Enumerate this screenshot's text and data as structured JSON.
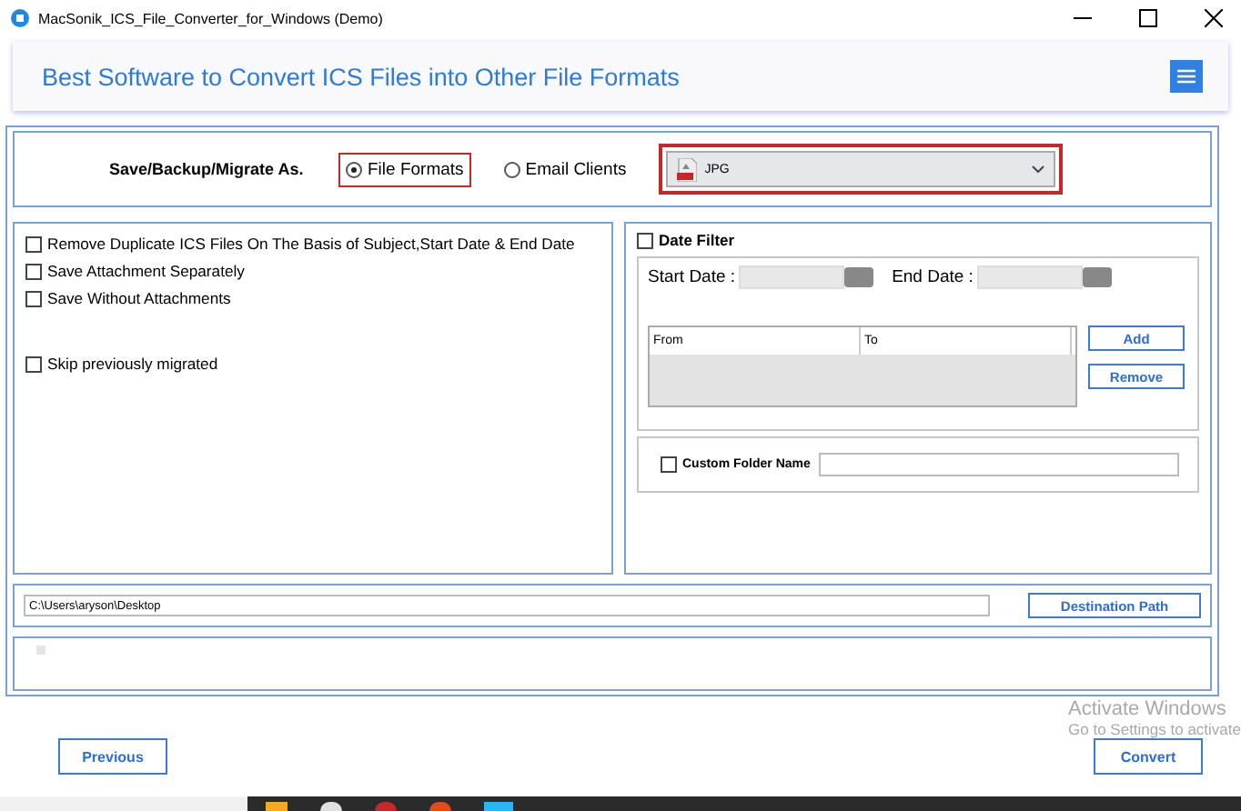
{
  "window": {
    "title": "MacSonik_ICS_File_Converter_for_Windows (Demo)"
  },
  "header": {
    "title": "Best Software to Convert ICS Files into Other File Formats"
  },
  "save_as": {
    "label": "Save/Backup/Migrate As.",
    "options": [
      {
        "label": "File Formats",
        "selected": true
      },
      {
        "label": "Email Clients",
        "selected": false
      }
    ],
    "format": "JPG"
  },
  "options": [
    {
      "label": "Remove Duplicate ICS Files On The Basis of Subject,Start Date & End Date",
      "checked": false
    },
    {
      "label": "Save Attachment Separately",
      "checked": false
    },
    {
      "label": "Save Without Attachments",
      "checked": false
    },
    {
      "label": "Skip previously migrated",
      "checked": false
    }
  ],
  "date_filter": {
    "label": "Date Filter",
    "checked": false,
    "start_label": "Start Date :",
    "end_label": "End Date :",
    "columns": [
      "From",
      "To"
    ],
    "buttons": [
      "Add",
      "Remove"
    ]
  },
  "custom_folder": {
    "label": "Custom Folder Name",
    "checked": false
  },
  "destination": {
    "path": "C:\\Users\\aryson\\Desktop",
    "button": "Destination Path"
  },
  "os_notice": {
    "title": "Activate Windows",
    "subtitle": "Go to Settings to activate"
  },
  "buttons": {
    "previous": "Previous",
    "convert": "Convert"
  }
}
